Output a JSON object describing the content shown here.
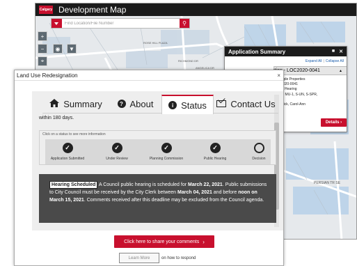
{
  "map": {
    "title": "Development Map",
    "logo_text": "Calgary",
    "search_placeholder": "Find Location/File Number",
    "labels": [
      "ROSE HILL PLAZA",
      "RICHMOND DR",
      "ANGELICA DR"
    ],
    "tools": {
      "zoom_in": "+",
      "zoom_out": "−"
    }
  },
  "app_summary": {
    "title": "Application Summary",
    "expand_all": "Expand All",
    "separator": "|",
    "collapse_all": "Collapse All",
    "record_label": "ition - LOC2020-0041",
    "details": [
      "ltiple Properties",
      "2020-0041",
      "ic Hearing",
      "1, MU-1, S-UN, S-SPR,",
      "r",
      "wick, Carol-Ann"
    ],
    "details_button": "Details",
    "map_street_label": "PERSIAN TR SE"
  },
  "dialog": {
    "title": "Land Use Redesignation",
    "close": "×",
    "tabs": [
      {
        "label": "Summary",
        "icon": "home-icon"
      },
      {
        "label": "About",
        "icon": "question-circle-icon"
      },
      {
        "label": "Status",
        "icon": "info-circle-icon"
      },
      {
        "label": "Contact Us",
        "icon": "envelope-icon"
      }
    ],
    "active_tab": "Status",
    "within_text": "within 180 days.",
    "status_hint": "Click on a status to see more information",
    "statuses": [
      {
        "label": "Application Submitted",
        "complete": true
      },
      {
        "label": "Under Review",
        "complete": true
      },
      {
        "label": "Planning Commission",
        "complete": true
      },
      {
        "label": "Public Hearing",
        "complete": true
      },
      {
        "label": "Decision",
        "complete": false
      }
    ],
    "notice": {
      "badge": "Hearing Scheduled",
      "p1": " A Council public hearing is scheduled for ",
      "date1": "March 22, 2021",
      "p2": ". Public submissions to City Council must be received by the City Clerk between ",
      "date2": "March 04, 2021",
      "p3": " and before ",
      "date3": "noon on March 15, 2021",
      "p4": ". Comments received after this deadline may be excluded from the Council agenda."
    },
    "share_button": "Click here to share your comments",
    "learn_more_button": "Learn More",
    "learn_more_suffix": "on how to respond"
  }
}
